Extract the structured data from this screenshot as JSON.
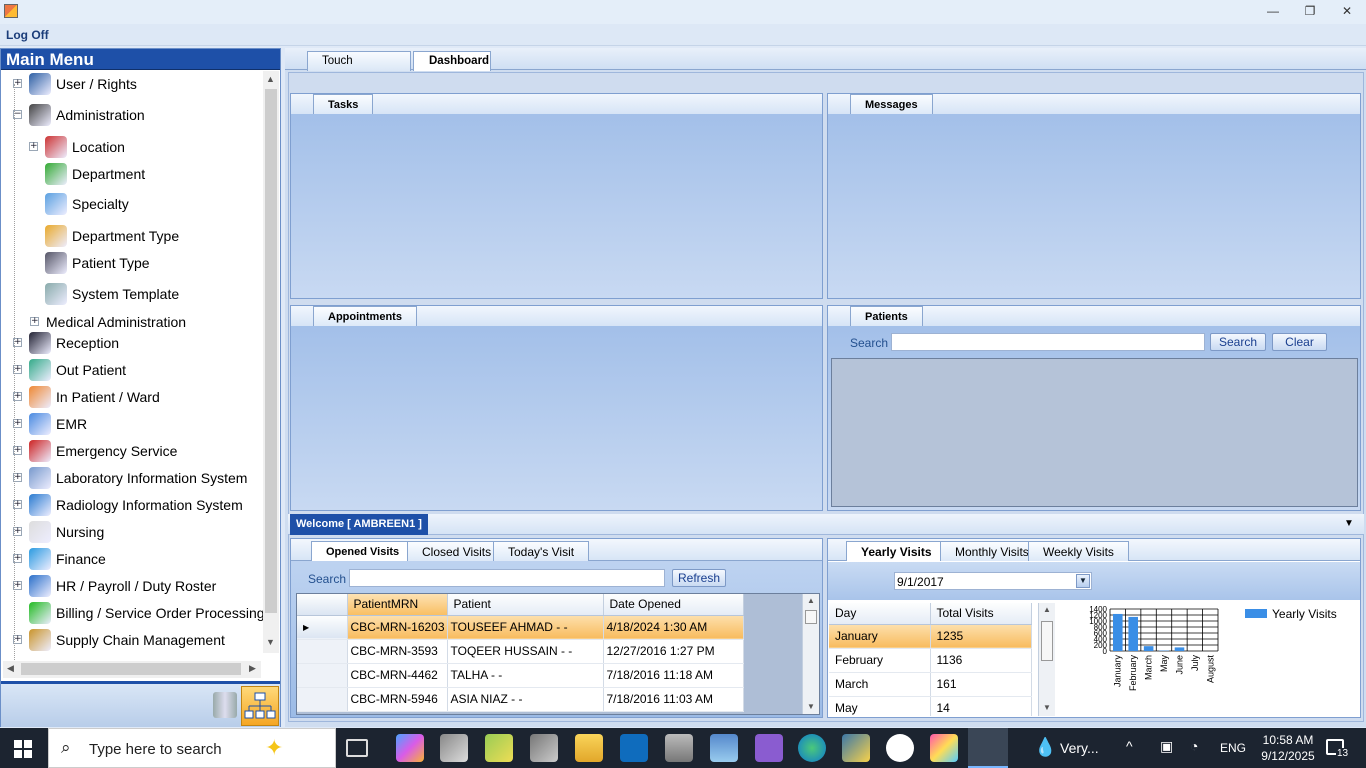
{
  "window": {
    "minimize_label": "—",
    "maximize_label": "❐",
    "close_label": "✕"
  },
  "menubar": {
    "log_off": "Log Off"
  },
  "sidebar": {
    "title": "Main Menu",
    "items": [
      {
        "label": "User / Rights",
        "icon": "user-rights-icon",
        "expander": "+"
      },
      {
        "label": "Administration",
        "icon": "administration-icon",
        "expander": "−"
      },
      {
        "label": "Location",
        "icon": "location-icon",
        "expander": "+"
      },
      {
        "label": "Department",
        "icon": "department-icon"
      },
      {
        "label": "Specialty",
        "icon": "specialty-icon"
      },
      {
        "label": "Department Type",
        "icon": "department-type-icon"
      },
      {
        "label": "Patient Type",
        "icon": "patient-type-icon"
      },
      {
        "label": "System Template",
        "icon": "system-template-icon"
      },
      {
        "label": "Medical Administration",
        "expander": "+"
      },
      {
        "label": "Reception",
        "icon": "reception-icon",
        "expander": "+"
      },
      {
        "label": "Out Patient",
        "icon": "out-patient-icon",
        "expander": "+"
      },
      {
        "label": "In Patient / Ward",
        "icon": "in-patient-icon",
        "expander": "+"
      },
      {
        "label": "EMR",
        "icon": "emr-icon",
        "expander": "+"
      },
      {
        "label": "Emergency Service",
        "icon": "emergency-icon",
        "expander": "+"
      },
      {
        "label": "Laboratory Information System",
        "icon": "lab-icon",
        "expander": "+"
      },
      {
        "label": "Radiology Information System",
        "icon": "radiology-icon",
        "expander": "+"
      },
      {
        "label": "Nursing",
        "icon": "nursing-icon",
        "expander": "+"
      },
      {
        "label": "Finance",
        "icon": "finance-icon",
        "expander": "+"
      },
      {
        "label": "HR / Payroll / Duty Roster",
        "icon": "hr-icon",
        "expander": "+"
      },
      {
        "label": "Billing / Service Order Processing",
        "icon": "billing-icon"
      },
      {
        "label": "Supply Chain Management",
        "icon": "supply-chain-icon",
        "expander": "+"
      }
    ]
  },
  "main_tabs": [
    "Touch Navigation",
    "Dashboard"
  ],
  "panels": {
    "tasks": "Tasks",
    "messages": "Messages",
    "appointments": "Appointments",
    "patients": "Patients",
    "patients_search_label": "Search",
    "patients_search_button": "Search",
    "patients_clear_button": "Clear"
  },
  "welcome": "Welcome [ AMBREEN1 ]",
  "visits": {
    "tabs": [
      "Opened Visits",
      "Closed Visits",
      "Today's Visit"
    ],
    "search_label": "Search",
    "refresh_button": "Refresh",
    "columns": [
      "PatientMRN",
      "Patient",
      "Date Opened"
    ],
    "rows": [
      [
        "CBC-MRN-16203",
        "TOUSEEF AHMAD - -",
        "4/18/2024 1:30 AM"
      ],
      [
        "CBC-MRN-3593",
        "TOQEER HUSSAIN - -",
        "12/27/2016 1:27 PM"
      ],
      [
        "CBC-MRN-4462",
        "TALHA - -",
        "7/18/2016 11:18 AM"
      ],
      [
        "CBC-MRN-5946",
        "ASIA NIAZ - -",
        "7/18/2016 11:03 AM"
      ]
    ]
  },
  "stats": {
    "tabs": [
      "Yearly Visits",
      "Monthly Visits",
      "Weekly Visits"
    ],
    "date_value": "9/1/2017",
    "columns": [
      "Day",
      "Total Visits"
    ],
    "rows": [
      [
        "January",
        "1235"
      ],
      [
        "February",
        "1136"
      ],
      [
        "March",
        "161"
      ],
      [
        "May",
        "14"
      ]
    ]
  },
  "chart_data": {
    "type": "bar",
    "categories": [
      "January",
      "February",
      "March",
      "May",
      "June",
      "July",
      "August"
    ],
    "series": [
      {
        "name": "Yearly Visits",
        "values": [
          1235,
          1136,
          161,
          14,
          120,
          0,
          0
        ]
      }
    ],
    "yticks": [
      "1400",
      "1200",
      "1000",
      "800",
      "600",
      "400",
      "200",
      "0"
    ],
    "ylim": [
      0,
      1400
    ],
    "grid": true,
    "legend": "top-right",
    "color": "#3a8ee6"
  },
  "taskbar": {
    "search_placeholder": "Type here to search",
    "weather": "Very...",
    "lang": "ENG",
    "time": "10:58 AM",
    "date": "9/12/2025",
    "notif_count": "13"
  }
}
